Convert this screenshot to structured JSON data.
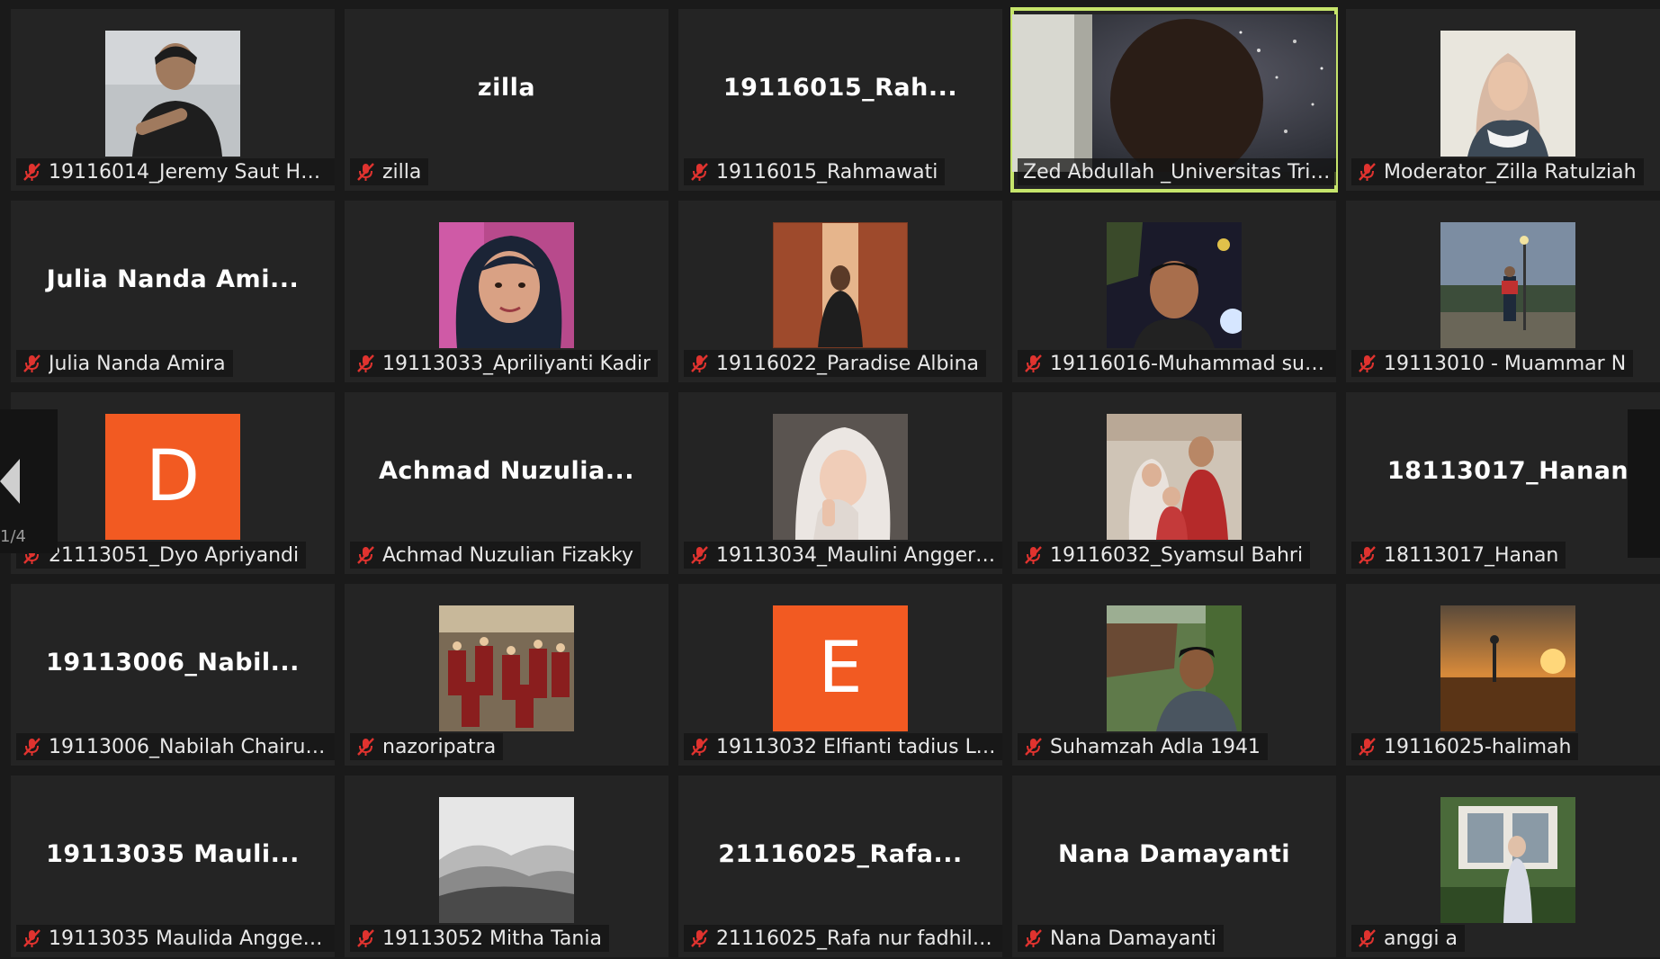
{
  "participants": [
    {
      "name": "19116014_Jeremy Saut Ha...",
      "video": "photo-boy-writing"
    },
    {
      "name": "zilla",
      "display": "zilla"
    },
    {
      "name": "19116015_Rahmawati",
      "display": "19116015_Rah..."
    },
    {
      "name": "Zed Abdullah _Universitas Tril...",
      "video": "live-camera",
      "speaking": true
    },
    {
      "name": "Moderator_Zilla Ratulziah",
      "video": "photo-woman-hijab"
    },
    {
      "name": "Julia Nanda Amira",
      "display": "Julia Nanda Ami..."
    },
    {
      "name": "19113033_Apriliyanti Kadir",
      "video": "photo-girl-selfie"
    },
    {
      "name": "19116022_Paradise Albina",
      "video": "photo-brick-corridor"
    },
    {
      "name": "19116016-Muhammad suri...",
      "video": "photo-man-night"
    },
    {
      "name": "19113010 - Muammar N",
      "video": "photo-man-landscape"
    },
    {
      "name": "21113051_Dyo Apriyandi",
      "letter": "D"
    },
    {
      "name": "Achmad Nuzulian Fizakky",
      "display": "Achmad  Nuzulia..."
    },
    {
      "name": "19113034_Maulini Anggeri...",
      "video": "photo-woman-white-hijab"
    },
    {
      "name": "19116032_Syamsul Bahri",
      "video": "photo-family"
    },
    {
      "name": "18113017_Hanan",
      "display": "18113017_Hanan"
    },
    {
      "name": "19113006_Nabilah Chairuni...",
      "display": "19113006_Nabil..."
    },
    {
      "name": "nazoripatra",
      "video": "photo-dancers"
    },
    {
      "name": "19113032 Elfianti tadius Lo...",
      "letter": "E"
    },
    {
      "name": "Suhamzah Adla 1941",
      "video": "photo-man-outdoor"
    },
    {
      "name": "19116025-halimah",
      "video": "photo-sunset"
    },
    {
      "name": "19113035 Maulida Anggeri...",
      "display": "19113035  Mauli..."
    },
    {
      "name": "19113052 Mitha Tania",
      "video": "photo-mountains"
    },
    {
      "name": "21116025_Rafa nur fadhilah",
      "display": "21116025_Rafa..."
    },
    {
      "name": "Nana Damayanti",
      "display": "Nana Damayanti"
    },
    {
      "name": "anggi a",
      "video": "photo-woman-garden"
    }
  ],
  "page_indicator": "1/4",
  "colors": {
    "speaking_outline": "#c6e56b",
    "avatar_letter_bg": "#f25a22",
    "muted_icon": "#e0332f"
  }
}
